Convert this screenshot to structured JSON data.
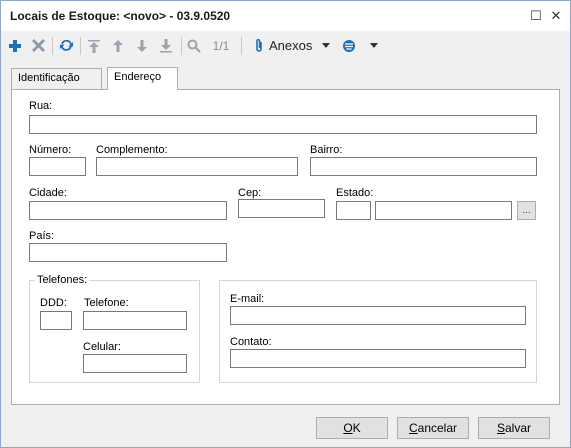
{
  "window": {
    "title": "Locais de Estoque: <novo> - 03.9.0520",
    "maximize_glyph": "☐",
    "close_glyph": "✕"
  },
  "toolbar": {
    "icons": [
      "plus-icon",
      "delete-icon",
      "refresh-icon",
      "first-record-icon",
      "previous-record-icon",
      "next-record-icon",
      "last-record-icon",
      "search-icon",
      "attachment-icon",
      "filter-icon",
      "dropdown-arrow-icon"
    ],
    "page_indicator": "1/1",
    "attachments_label": "Anexos",
    "accent_color": "#1e6fb8"
  },
  "tabs": [
    {
      "label": "Identificação",
      "active": false
    },
    {
      "label": "Endereço",
      "active": true
    }
  ],
  "form": {
    "rua_label": "Rua:",
    "rua_value": "",
    "numero_label": "Número:",
    "numero_value": "",
    "complemento_label": "Complemento:",
    "complemento_value": "",
    "bairro_label": "Bairro:",
    "bairro_value": "",
    "cidade_label": "Cidade:",
    "cidade_value": "",
    "cep_label": "Cep:",
    "cep_value": "",
    "estado_label": "Estado:",
    "estado_code": "",
    "estado_name": "",
    "estado_lookup": "...",
    "pais_label": "País:",
    "pais_value": ""
  },
  "telefones": {
    "group_label": "Telefones:",
    "ddd_label": "DDD:",
    "ddd_value": "",
    "telefone_label": "Telefone:",
    "telefone_value": "",
    "celular_label": "Celular:",
    "celular_value": ""
  },
  "contact": {
    "email_label": "E-mail:",
    "email_value": "",
    "contato_label": "Contato:",
    "contato_value": ""
  },
  "buttons": {
    "ok_key": "O",
    "ok_rest": "K",
    "cancel_key": "C",
    "cancel_rest": "ancelar",
    "save_key": "S",
    "save_rest": "alvar"
  }
}
